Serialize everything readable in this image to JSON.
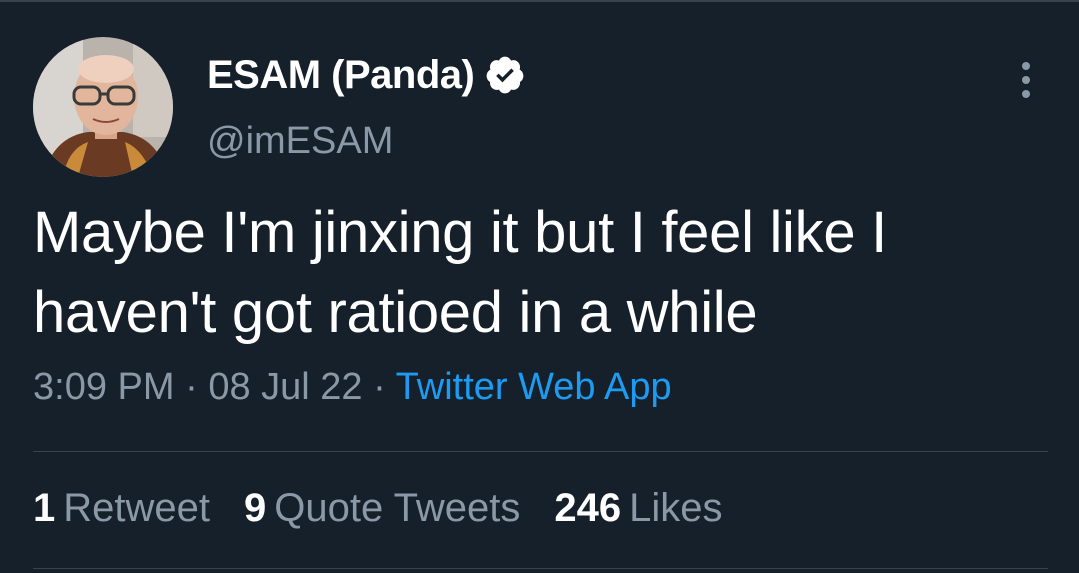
{
  "user": {
    "display_name": "ESAM (Panda)",
    "handle": "@imESAM",
    "verified": true
  },
  "tweet": {
    "text": "Maybe I'm jinxing it but I feel like I haven't got ratioed in a while",
    "time": "3:09 PM",
    "date": "08 Jul 22",
    "source": "Twitter Web App",
    "separator": "·"
  },
  "stats": {
    "retweets": {
      "count": "1",
      "label": "Retweet"
    },
    "quotes": {
      "count": "9",
      "label": "Quote Tweets"
    },
    "likes": {
      "count": "246",
      "label": "Likes"
    }
  },
  "colors": {
    "background": "#15202b",
    "text_primary": "#ffffff",
    "text_secondary": "#8b98a5",
    "link": "#1d9bf0",
    "verified": "#ffffff",
    "divider": "#38444d"
  },
  "icons": {
    "verified": "verified-badge-icon",
    "more": "more-options-icon"
  }
}
